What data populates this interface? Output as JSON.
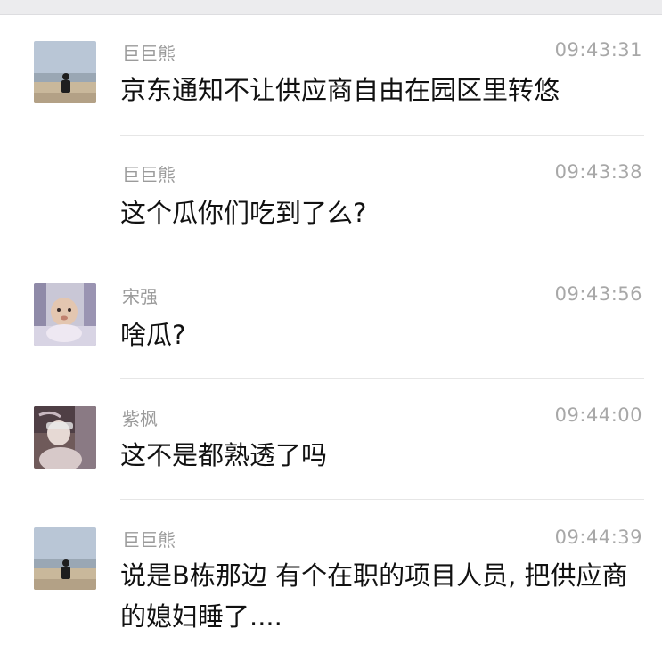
{
  "header": {
    "title": ""
  },
  "messages": [
    {
      "name": "巨巨熊",
      "time": "09:43:31",
      "text": "京东通知不让供应商自由在园区里转悠",
      "avatar_icon": "beach-figure-avatar"
    },
    {
      "name": "巨巨熊",
      "time": "09:43:38",
      "text": "这个瓜你们吃到了么?",
      "avatar_icon": ""
    },
    {
      "name": "宋强",
      "time": "09:43:56",
      "text": "啥瓜?",
      "avatar_icon": "baby-avatar"
    },
    {
      "name": "紫枫",
      "time": "09:44:00",
      "text": "这不是都熟透了吗",
      "avatar_icon": "person-photo-avatar"
    },
    {
      "name": "巨巨熊",
      "time": "09:44:39",
      "text": "说是B栋那边 有个在职的项目人员, 把供应商的媳妇睡了....",
      "avatar_icon": "beach-figure-avatar"
    }
  ],
  "colors": {
    "name": "#9b9b9b",
    "time": "#a8a8a8",
    "text": "#111111",
    "divider": "#e6e6e6",
    "topbar": "#ececee"
  }
}
